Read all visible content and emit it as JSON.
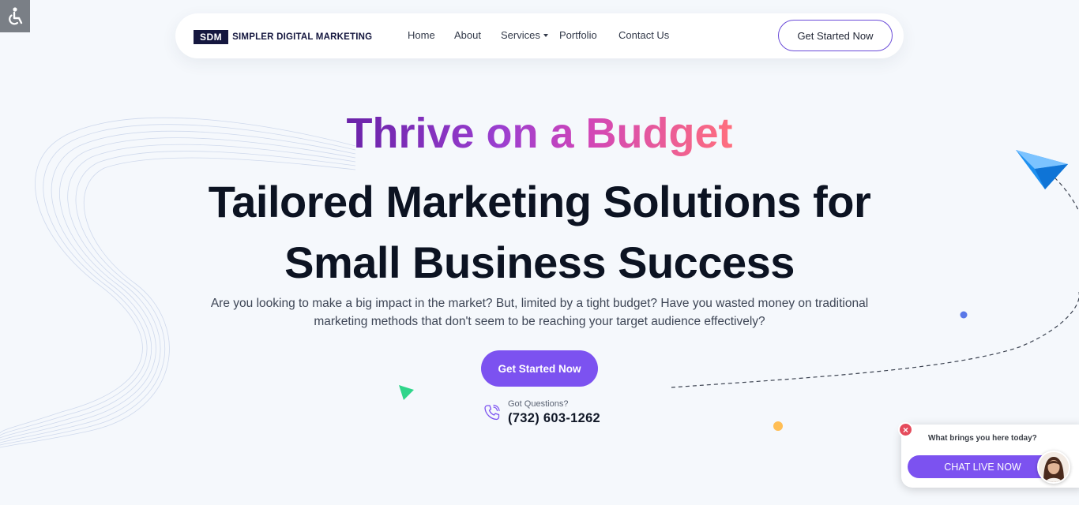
{
  "logo": {
    "abbr": "SDM",
    "name": "SIMPLER DIGITAL MARKETING"
  },
  "nav": {
    "items": [
      "Home",
      "About",
      "Services",
      "Portfolio",
      "Contact Us"
    ],
    "cta": "Get Started Now"
  },
  "hero": {
    "tagline": "Thrive on a Budget",
    "headline_line1": "Tailored Marketing Solutions for",
    "headline_line2": "Small Business Success",
    "description": "Are you looking to make a big impact in the market? But, limited by a tight budget? Have you wasted money on traditional marketing methods that don't seem to be reaching your target audience effectively?",
    "cta": "Get Started Now",
    "questions_label": "Got Questions?",
    "phone": "(732) 603-1262"
  },
  "chat": {
    "question": "What brings you here today?",
    "button": "CHAT LIVE NOW",
    "close": "×"
  },
  "colors": {
    "accent": "#7c52f0",
    "navy": "#15173f",
    "background": "#f5f8fc",
    "gradient_start": "#6a22a8",
    "gradient_end": "#ff6f7d"
  },
  "icons": [
    "accessibility-icon",
    "phone-icon",
    "paper-plane-icon",
    "triangle-icon",
    "chat-avatar",
    "close-icon"
  ]
}
